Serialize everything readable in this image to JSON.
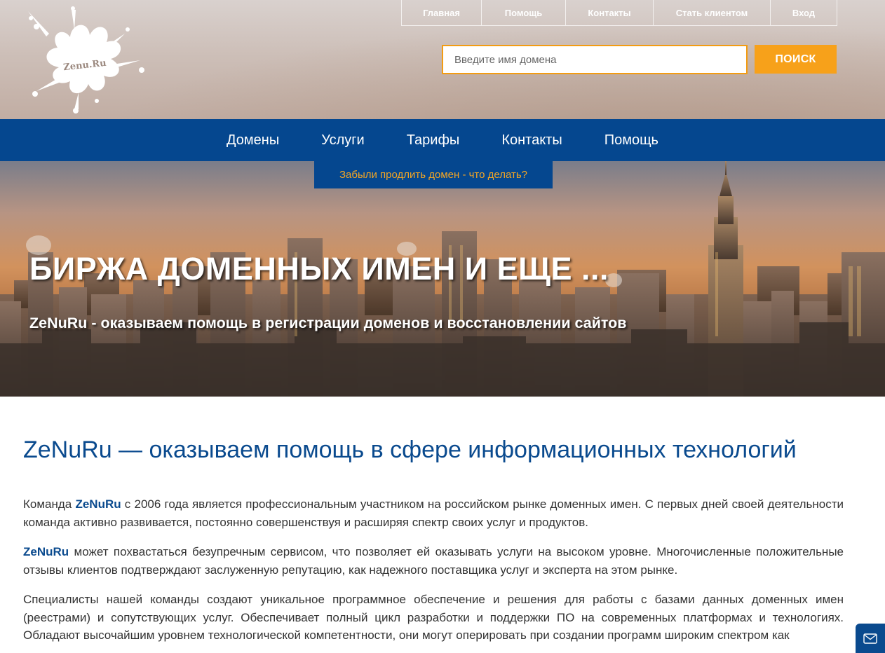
{
  "header": {
    "logo_text": "Zenu.Ru",
    "top_nav": [
      {
        "label": "Главная"
      },
      {
        "label": "Помощь"
      },
      {
        "label": "Контакты"
      },
      {
        "label": "Стать клиентом"
      },
      {
        "label": "Вход"
      }
    ],
    "search": {
      "placeholder": "Введите имя домена",
      "value": "",
      "button_label": "ПОИСК"
    }
  },
  "main_nav": [
    {
      "label": "Домены"
    },
    {
      "label": "Услуги"
    },
    {
      "label": "Тарифы"
    },
    {
      "label": "Контакты"
    },
    {
      "label": "Помощь"
    }
  ],
  "dropdown": {
    "item_label": "Забыли продлить домен - что делать?"
  },
  "hero": {
    "title": "БИРЖА ДОМЕННЫХ ИМЕН И ЕЩЕ ...",
    "subtitle": "ZeNuRu - оказываем помощь в регистрации доменов и восстановлении сайтов"
  },
  "content": {
    "heading": "ZeNuRu — оказываем помощь в сфере информационных технологий",
    "brand": "ZeNuRu",
    "p1_before": "Команда ",
    "p1_after": " с 2006 года является профессиональным участником на российском рынке доменных имен. С первых дней своей деятельности команда активно развивается, постоянно совершенствуя и расширяя спектр своих услуг и продуктов.",
    "p2_after": " может похвастаться безупречным сервисом, что позволяет ей оказывать услуги на высоком уровне. Многочисленные положительные отзывы клиентов подтверждают заслуженную репутацию, как надежного поставщика услуг и эксперта на этом рынке.",
    "p3": "Специалисты нашей команды создают уникальное программное обеспечение и решения для работы с базами данных доменных имен (реестрами) и сопутствующих услуг. Обеспечивает полный цикл разработки и поддержки ПО на современных платформах и технологиях. Обладают высочайшим уровнем технологической компетентности, они могут оперировать при создании программ широким спектром как"
  },
  "widgets": {
    "mail_icon": "envelope-icon"
  },
  "colors": {
    "brand_blue": "#05478f",
    "accent_orange": "#f7a11a",
    "heading_blue": "#0a4a8e",
    "body_text": "#333333"
  }
}
